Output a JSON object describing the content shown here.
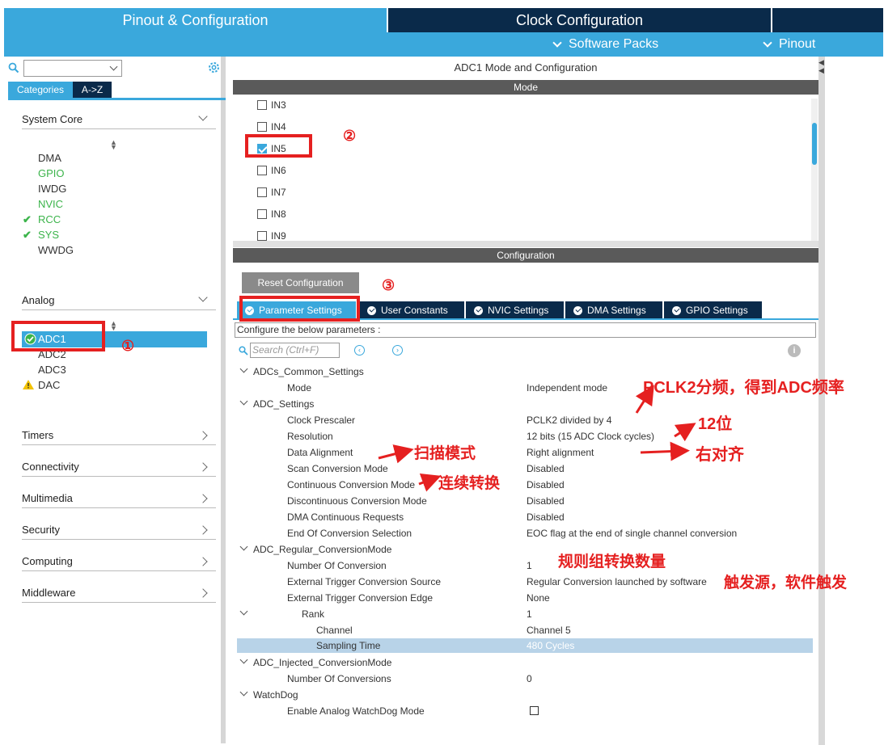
{
  "top_tabs": {
    "pinout": "Pinout & Configuration",
    "clock": "Clock Configuration"
  },
  "sub_menu": {
    "software_packs": "Software Packs",
    "pinout": "Pinout"
  },
  "left": {
    "category_tab": "Categories",
    "az_tab": "A->Z",
    "groups": {
      "system_core": "System Core",
      "analog": "Analog",
      "timers": "Timers",
      "connectivity": "Connectivity",
      "multimedia": "Multimedia",
      "security": "Security",
      "computing": "Computing",
      "middleware": "Middleware"
    },
    "system_core_items": [
      "DMA",
      "GPIO",
      "IWDG",
      "NVIC",
      "RCC",
      "SYS",
      "WWDG"
    ],
    "analog_items": [
      "ADC1",
      "ADC2",
      "ADC3",
      "DAC"
    ]
  },
  "right": {
    "title": "ADC1 Mode and Configuration",
    "mode_bar": "Mode",
    "config_bar": "Configuration",
    "mode_channels": [
      "IN3",
      "IN4",
      "IN5",
      "IN6",
      "IN7",
      "IN8",
      "IN9"
    ],
    "reset_button": "Reset Configuration",
    "tabs": [
      "Parameter Settings",
      "User Constants",
      "NVIC Settings",
      "DMA Settings",
      "GPIO Settings"
    ],
    "config_note": "Configure the below parameters :",
    "search_placeholder": "Search (Ctrl+F)",
    "params": {
      "common": "ADCs_Common_Settings",
      "mode_k": "Mode",
      "mode_v": "Independent mode",
      "adc": "ADC_Settings",
      "prescaler_k": "Clock Prescaler",
      "prescaler_v": "PCLK2 divided by 4",
      "resolution_k": "Resolution",
      "resolution_v": "12 bits (15 ADC Clock cycles)",
      "align_k": "Data Alignment",
      "align_v": "Right alignment",
      "scan_k": "Scan Conversion Mode",
      "scan_v": "Disabled",
      "cont_k": "Continuous Conversion Mode",
      "cont_v": "Disabled",
      "disc_k": "Discontinuous Conversion Mode",
      "disc_v": "Disabled",
      "dma_k": "DMA Continuous Requests",
      "dma_v": "Disabled",
      "eoc_k": "End Of Conversion Selection",
      "eoc_v": "EOC flag at the end of single channel conversion",
      "regular": "ADC_Regular_ConversionMode",
      "nconv_k": "Number Of Conversion",
      "nconv_v": "1",
      "trig_src_k": "External Trigger Conversion Source",
      "trig_src_v": "Regular Conversion launched by software",
      "trig_edge_k": "External Trigger Conversion Edge",
      "trig_edge_v": "None",
      "rank_k": "Rank",
      "rank_v": "1",
      "channel_k": "Channel",
      "channel_v": "Channel 5",
      "sampling_k": "Sampling Time",
      "sampling_v": "480 Cycles",
      "injected": "ADC_Injected_ConversionMode",
      "inj_nconv_k": "Number Of Conversions",
      "inj_nconv_v": "0",
      "watchdog": "WatchDog",
      "wd_enable_k": "Enable Analog WatchDog Mode"
    }
  },
  "annotations": {
    "n1": "①",
    "n2": "②",
    "n3": "③",
    "pclk": "PCLK2分频，得到ADC频率",
    "bits": "12位",
    "right_align": "右对齐",
    "scan": "扫描模式",
    "continuous": "连续转换",
    "regular_count": "规则组转换数量",
    "trigger": "触发源，软件触发"
  },
  "colors": {
    "accent": "#3aa8dc",
    "dark_navy": "#0a2a4a",
    "annotation_red": "#e52020",
    "ok_green": "#3cb44b"
  }
}
